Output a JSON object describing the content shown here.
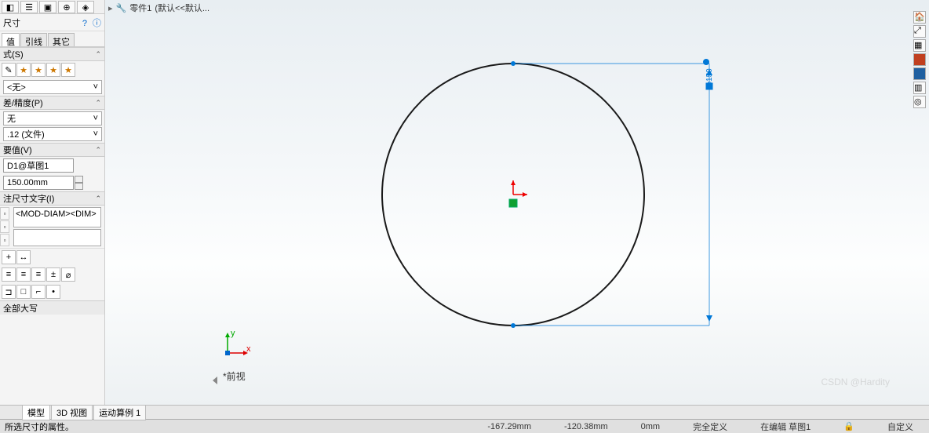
{
  "breadcrumb": {
    "part": "零件1",
    "suffix": "(默认<<默认..."
  },
  "panel": {
    "title": "尺寸",
    "help1": "?",
    "help2": "ⓘ",
    "subtabs": [
      "值",
      "引线",
      "其它"
    ],
    "section_style": "式(S)",
    "style_dd": "<无>",
    "section_tol": "差/精度(P)",
    "tol_dd1": "无",
    "tol_dd2": ".12 (文件)",
    "section_primary": "要值(V)",
    "primary_name": "D1@草图1",
    "primary_value": "150.00mm",
    "section_dimtxt": "注尺寸文字(I)",
    "dimtxt_value": "<MOD-DIAM><DIM>",
    "section_allcaps": "全部大写"
  },
  "viewport": {
    "dim_label": "⌀150",
    "view_name": "*前视",
    "axis_x": "x",
    "axis_y": "y"
  },
  "bottom_tabs": {
    "model": "模型",
    "d3": "3D 视图",
    "motion": "运动算例 1"
  },
  "status": {
    "hint": "所选尺寸的属性。",
    "coord1": "-167.29mm",
    "coord2": "-120.38mm",
    "coord3": "0mm",
    "defined": "完全定义",
    "editing": "在编辑 草图1",
    "custom": "自定义"
  },
  "watermark": "CSDN @Hardity"
}
